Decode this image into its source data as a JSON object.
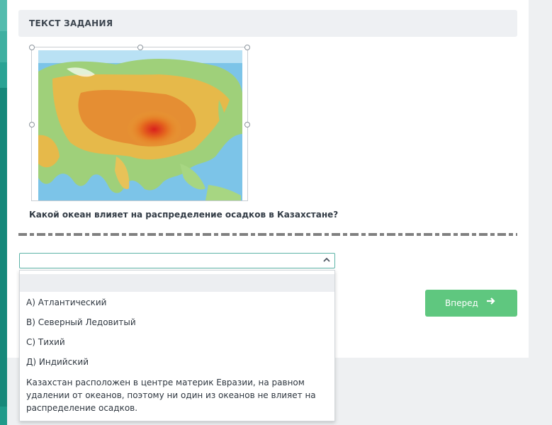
{
  "section_title": "ТЕКСТ ЗАДАНИЯ",
  "image": {
    "icon": "asia-physical-map"
  },
  "question": "Какой океан влияет на распределение осадков в Казахстане?",
  "select": {
    "selected_value": "",
    "chevron_icon": "chevron-up-icon"
  },
  "options": [
    "",
    "А) Атлантический",
    "В) Северный Ледовитый",
    "С) Тихий",
    "Д) Индийский",
    "Казахстан расположен в центре материк Евразии, на равном удалении от океанов, поэтому ни один из океанов не влияет на распределение осадков."
  ],
  "next_button": {
    "label": "Вперед",
    "icon": "arrow-right-icon"
  },
  "colors": {
    "accent_teal": "#1f9a8a",
    "button_green": "#5fc77f",
    "select_border": "#5db3a7"
  }
}
